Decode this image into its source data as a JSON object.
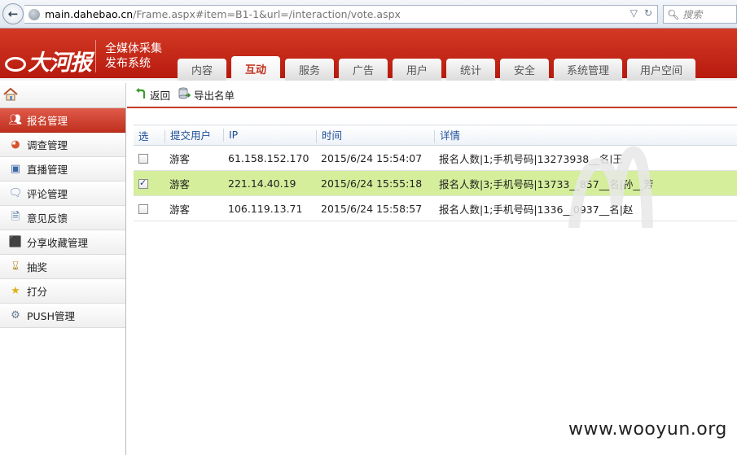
{
  "browser": {
    "url_host": "main.dahebao.cn",
    "url_path": "/Frame.aspx#item=B1-1&url=/interaction/vote.aspx",
    "search_placeholder": "搜索"
  },
  "header": {
    "logo": "大河报",
    "subtitle_line1": "全媒体采集",
    "subtitle_line2": "发布系统",
    "tabs": [
      {
        "label": "内容",
        "width": 60
      },
      {
        "label": "互动",
        "width": 60,
        "active": true
      },
      {
        "label": "服务",
        "width": 60
      },
      {
        "label": "广告",
        "width": 60
      },
      {
        "label": "用户",
        "width": 60
      },
      {
        "label": "统计",
        "width": 60
      },
      {
        "label": "安全",
        "width": 60
      },
      {
        "label": "系统管理",
        "width": 84
      },
      {
        "label": "用户空间",
        "width": 84
      }
    ]
  },
  "toolbar": {
    "back_label": "返回",
    "export_label": "导出名单"
  },
  "sidebar": {
    "items": [
      {
        "label": "报名管理",
        "icon": "users-icon",
        "active": true
      },
      {
        "label": "调查管理",
        "icon": "pie-chart-icon"
      },
      {
        "label": "直播管理",
        "icon": "presentation-icon"
      },
      {
        "label": "评论管理",
        "icon": "comment-icon"
      },
      {
        "label": "意见反馈",
        "icon": "document-icon"
      },
      {
        "label": "分享收藏管理",
        "icon": "share-icon"
      },
      {
        "label": "抽奖",
        "icon": "hourglass-icon"
      },
      {
        "label": "打分",
        "icon": "star-icon"
      },
      {
        "label": "PUSH管理",
        "icon": "gear-icon"
      }
    ]
  },
  "table": {
    "headers": [
      "选",
      "提交用户",
      "IP",
      "时间",
      "详情"
    ],
    "rows": [
      {
        "checked": false,
        "user": "游客",
        "ip": "61.158.152.170",
        "time": "2015/6/24 15:54:07",
        "detail": "报名人数|1;手机号码|13273938__名|王"
      },
      {
        "checked": true,
        "user": "游客",
        "ip": "221.14.40.19",
        "time": "2015/6/24 15:55:18",
        "detail": "报名人数|3;手机号码|13733__857__名|孙__芳"
      },
      {
        "checked": false,
        "user": "游客",
        "ip": "106.119.13.71",
        "time": "2015/6/24 15:58:57",
        "detail": "报名人数|1;手机号码|1336__0937__名|赵"
      }
    ]
  },
  "watermark": "www.wooyun.org"
}
